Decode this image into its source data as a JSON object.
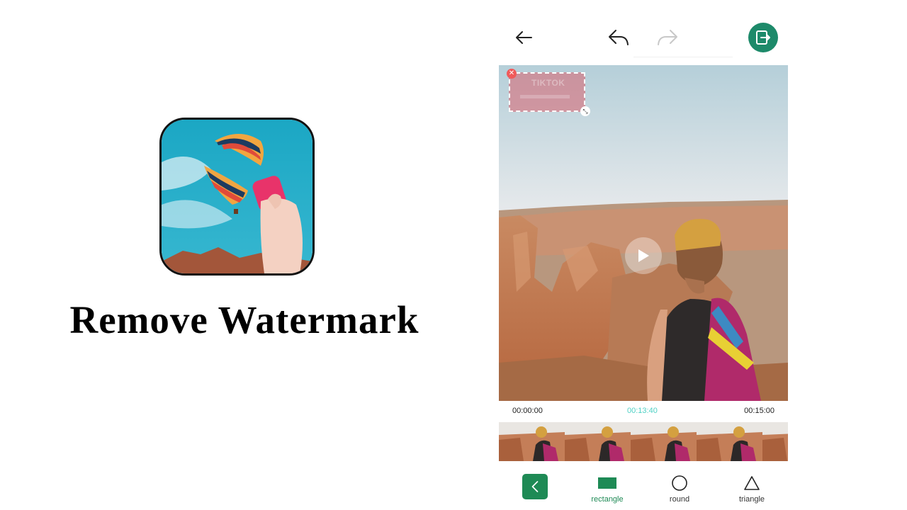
{
  "promo": {
    "title": "Remove Watermark",
    "app_icon": "balloon-eraser-app-icon"
  },
  "toolbar": {
    "back_icon": "arrow-left-icon",
    "undo_icon": "undo-icon",
    "redo_icon": "redo-icon",
    "export_icon": "export-icon",
    "accent_color": "#1d8a6a"
  },
  "video": {
    "watermark_label": "TIKTOK",
    "watermark_close_icon": "✕",
    "watermark_resize_icon": "⤡",
    "play_icon": "play-icon"
  },
  "timeline": {
    "start": "00:00:00",
    "current": "00:13:40",
    "end": "00:15:00",
    "current_color": "#4fd1c5"
  },
  "shapes": {
    "back_icon": "chevron-left-icon",
    "items": [
      {
        "label": "rectangle",
        "icon": "rectangle-icon",
        "active": true
      },
      {
        "label": "round",
        "icon": "circle-icon",
        "active": false
      },
      {
        "label": "triangle",
        "icon": "triangle-icon",
        "active": false
      }
    ],
    "active_color": "#1e8a55"
  }
}
